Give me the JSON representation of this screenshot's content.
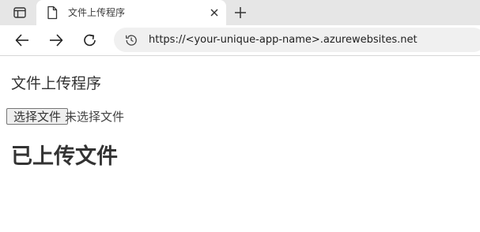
{
  "browser": {
    "tab": {
      "title": "文件上传程序",
      "close_icon": "close-icon",
      "favicon_icon": "page-icon"
    },
    "tab_actions_icon": "tab-actions-icon",
    "new_tab_icon": "plus-icon",
    "toolbar": {
      "back_icon": "arrow-left-icon",
      "forward_icon": "arrow-right-icon",
      "reload_icon": "reload-icon",
      "site_info_icon": "history-icon"
    },
    "address": {
      "url": "https://<your-unique-app-name>.azurewebsites.net"
    }
  },
  "page": {
    "heading": "文件上传程序",
    "file_input": {
      "button_label": "选择文件",
      "status_text": "未选择文件"
    },
    "uploaded_heading": "已上传文件"
  }
}
